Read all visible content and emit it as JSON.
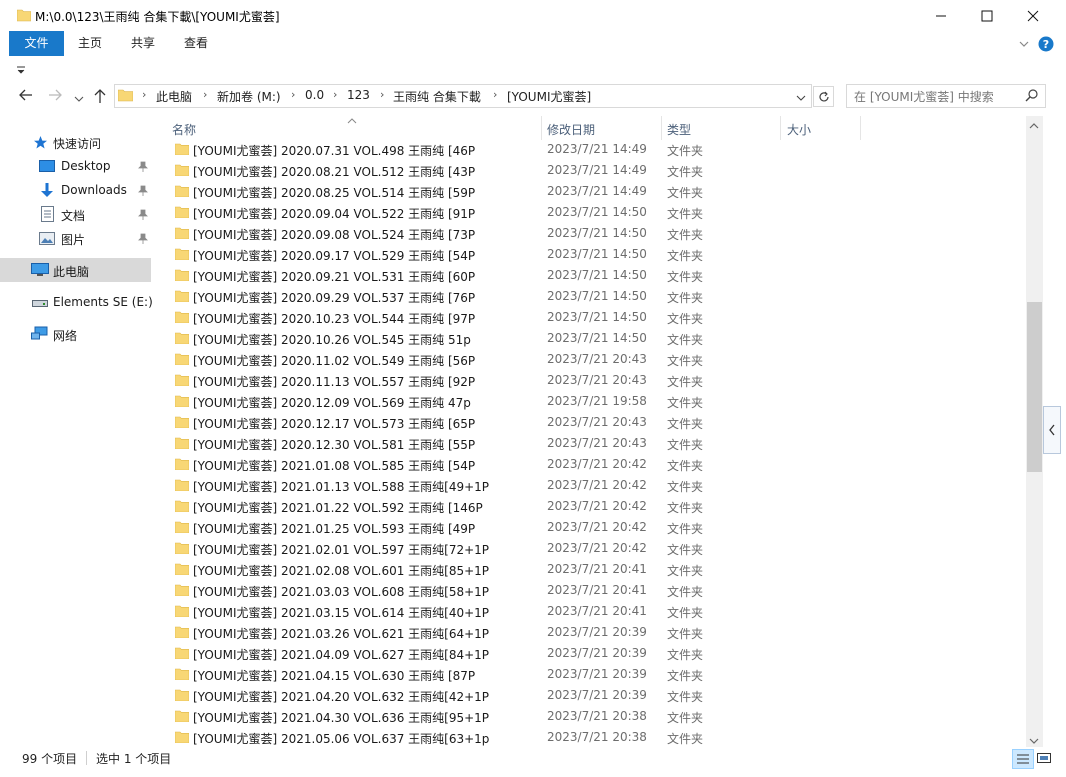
{
  "window": {
    "title": "M:\\0.0\\123\\王雨纯 合集下載\\[YOUMI尤蜜荟]"
  },
  "ribbon": {
    "tabs": [
      "文件",
      "主页",
      "共享",
      "查看"
    ]
  },
  "address": {
    "crumbs": [
      "此电脑",
      "新加卷 (M:)",
      "0.0",
      "123",
      "王雨纯 合集下載",
      "[YOUMI尤蜜荟]"
    ]
  },
  "search": {
    "placeholder": "在 [YOUMI尤蜜荟] 中搜索"
  },
  "nav": {
    "quick_access": "快速访问",
    "desktop": "Desktop",
    "downloads": "Downloads",
    "documents": "文档",
    "pictures": "图片",
    "this_pc": "此电脑",
    "elements": "Elements SE (E:)",
    "network": "网络"
  },
  "columns": {
    "name": "名称",
    "date": "修改日期",
    "type": "类型",
    "size": "大小"
  },
  "files": [
    {
      "name": "[YOUMI尤蜜荟] 2020.07.31 VOL.498 王雨纯 [46P",
      "date": "2023/7/21 14:49",
      "type": "文件夹"
    },
    {
      "name": "[YOUMI尤蜜荟] 2020.08.21 VOL.512 王雨纯 [43P",
      "date": "2023/7/21 14:49",
      "type": "文件夹"
    },
    {
      "name": "[YOUMI尤蜜荟] 2020.08.25 VOL.514 王雨纯 [59P",
      "date": "2023/7/21 14:49",
      "type": "文件夹"
    },
    {
      "name": "[YOUMI尤蜜荟] 2020.09.04 VOL.522 王雨纯 [91P",
      "date": "2023/7/21 14:50",
      "type": "文件夹"
    },
    {
      "name": "[YOUMI尤蜜荟] 2020.09.08 VOL.524 王雨纯 [73P",
      "date": "2023/7/21 14:50",
      "type": "文件夹"
    },
    {
      "name": "[YOUMI尤蜜荟] 2020.09.17 VOL.529 王雨纯 [54P",
      "date": "2023/7/21 14:50",
      "type": "文件夹"
    },
    {
      "name": "[YOUMI尤蜜荟] 2020.09.21 VOL.531 王雨纯 [60P",
      "date": "2023/7/21 14:50",
      "type": "文件夹"
    },
    {
      "name": "[YOUMI尤蜜荟] 2020.09.29 VOL.537 王雨纯 [76P",
      "date": "2023/7/21 14:50",
      "type": "文件夹"
    },
    {
      "name": "[YOUMI尤蜜荟] 2020.10.23 VOL.544 王雨纯 [97P",
      "date": "2023/7/21 14:50",
      "type": "文件夹"
    },
    {
      "name": "[YOUMI尤蜜荟] 2020.10.26 VOL.545 王雨纯 51p",
      "date": "2023/7/21 14:50",
      "type": "文件夹"
    },
    {
      "name": "[YOUMI尤蜜荟] 2020.11.02 VOL.549 王雨纯 [56P",
      "date": "2023/7/21 20:43",
      "type": "文件夹"
    },
    {
      "name": "[YOUMI尤蜜荟] 2020.11.13 VOL.557 王雨纯 [92P",
      "date": "2023/7/21 20:43",
      "type": "文件夹"
    },
    {
      "name": "[YOUMI尤蜜荟] 2020.12.09 VOL.569 王雨纯 47p",
      "date": "2023/7/21 19:58",
      "type": "文件夹"
    },
    {
      "name": "[YOUMI尤蜜荟] 2020.12.17 VOL.573 王雨纯 [65P",
      "date": "2023/7/21 20:43",
      "type": "文件夹"
    },
    {
      "name": "[YOUMI尤蜜荟] 2020.12.30 VOL.581 王雨纯 [55P",
      "date": "2023/7/21 20:43",
      "type": "文件夹"
    },
    {
      "name": "[YOUMI尤蜜荟] 2021.01.08 VOL.585 王雨纯 [54P",
      "date": "2023/7/21 20:42",
      "type": "文件夹"
    },
    {
      "name": "[YOUMI尤蜜荟] 2021.01.13 VOL.588 王雨纯[49+1P",
      "date": "2023/7/21 20:42",
      "type": "文件夹"
    },
    {
      "name": "[YOUMI尤蜜荟] 2021.01.22 VOL.592 王雨纯 [146P",
      "date": "2023/7/21 20:42",
      "type": "文件夹"
    },
    {
      "name": "[YOUMI尤蜜荟] 2021.01.25 VOL.593 王雨纯 [49P",
      "date": "2023/7/21 20:42",
      "type": "文件夹"
    },
    {
      "name": "[YOUMI尤蜜荟] 2021.02.01 VOL.597 王雨纯[72+1P",
      "date": "2023/7/21 20:42",
      "type": "文件夹"
    },
    {
      "name": "[YOUMI尤蜜荟] 2021.02.08 VOL.601 王雨纯[85+1P",
      "date": "2023/7/21 20:41",
      "type": "文件夹"
    },
    {
      "name": "[YOUMI尤蜜荟] 2021.03.03 VOL.608 王雨纯[58+1P",
      "date": "2023/7/21 20:41",
      "type": "文件夹"
    },
    {
      "name": "[YOUMI尤蜜荟] 2021.03.15 VOL.614 王雨纯[40+1P",
      "date": "2023/7/21 20:41",
      "type": "文件夹"
    },
    {
      "name": "[YOUMI尤蜜荟] 2021.03.26 VOL.621 王雨纯[64+1P",
      "date": "2023/7/21 20:39",
      "type": "文件夹"
    },
    {
      "name": "[YOUMI尤蜜荟] 2021.04.09 VOL.627 王雨纯[84+1P",
      "date": "2023/7/21 20:39",
      "type": "文件夹"
    },
    {
      "name": "[YOUMI尤蜜荟] 2021.04.15 VOL.630 王雨纯 [87P",
      "date": "2023/7/21 20:39",
      "type": "文件夹"
    },
    {
      "name": "[YOUMI尤蜜荟] 2021.04.20 VOL.632 王雨纯[42+1P",
      "date": "2023/7/21 20:39",
      "type": "文件夹"
    },
    {
      "name": "[YOUMI尤蜜荟] 2021.04.30 VOL.636 王雨纯[95+1P",
      "date": "2023/7/21 20:38",
      "type": "文件夹"
    },
    {
      "name": "[YOUMI尤蜜荟] 2021.05.06 VOL.637 王雨纯[63+1p",
      "date": "2023/7/21 20:38",
      "type": "文件夹"
    }
  ],
  "status": {
    "count": "99 个项目",
    "selected": "选中 1 个项目"
  },
  "colors": {
    "accent": "#1979ca",
    "folder": "#f8d775",
    "selection": "#cce8ff"
  }
}
